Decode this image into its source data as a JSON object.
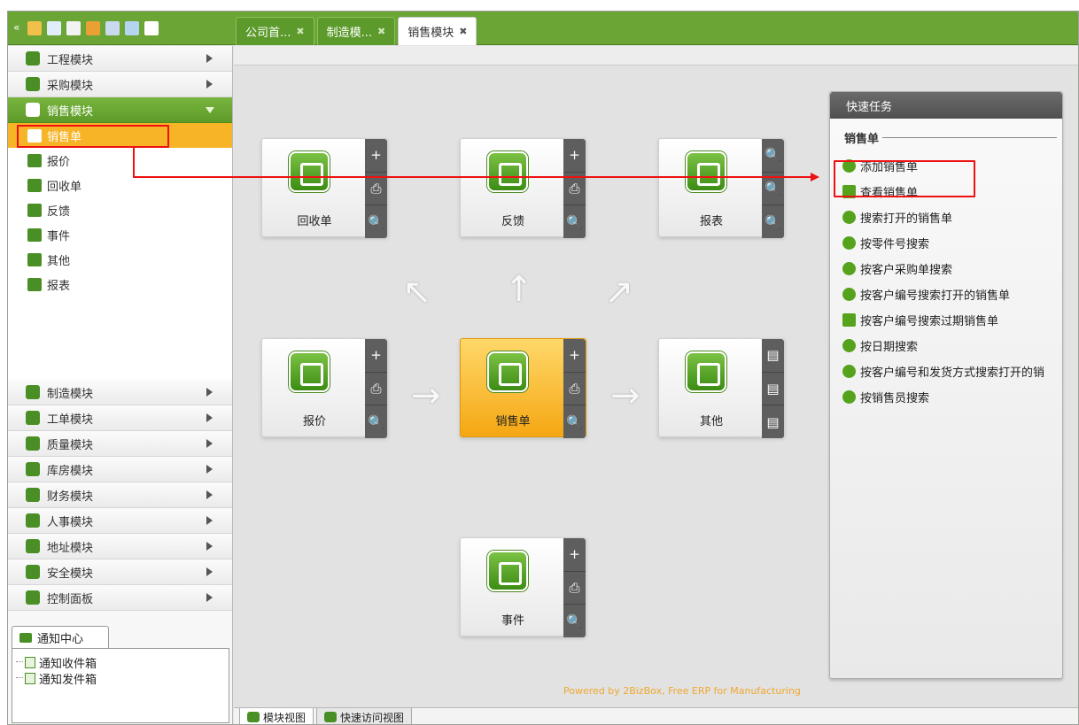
{
  "tabs": [
    {
      "label": "公司首...",
      "active": false
    },
    {
      "label": "制造模...",
      "active": false
    },
    {
      "label": "销售模块",
      "active": true
    }
  ],
  "tab_close_glyph": "✖",
  "sidebar": {
    "modules_top": [
      {
        "label": "工程模块",
        "icon": "module-icon"
      },
      {
        "label": "采购模块",
        "icon": "module-icon"
      },
      {
        "label": "销售模块",
        "icon": "module-icon",
        "open": true
      }
    ],
    "sub_items": [
      {
        "label": "销售单",
        "icon": "sales-order-icon",
        "selected": true
      },
      {
        "label": "报价",
        "icon": "quote-icon"
      },
      {
        "label": "回收单",
        "icon": "return-icon"
      },
      {
        "label": "反馈",
        "icon": "feedback-icon"
      },
      {
        "label": "事件",
        "icon": "event-icon"
      },
      {
        "label": "其他",
        "icon": "other-icon"
      },
      {
        "label": "报表",
        "icon": "report-icon"
      }
    ],
    "modules_bottom": [
      {
        "label": "制造模块"
      },
      {
        "label": "工单模块"
      },
      {
        "label": "质量模块"
      },
      {
        "label": "库房模块"
      },
      {
        "label": "财务模块"
      },
      {
        "label": "人事模块"
      },
      {
        "label": "地址模块"
      },
      {
        "label": "安全模块"
      },
      {
        "label": "控制面板"
      }
    ],
    "notify_tab": "通知中心",
    "notify_items": [
      "通知收件箱",
      "通知发件箱"
    ]
  },
  "cards": {
    "return": {
      "label": "回收单",
      "side": [
        "+",
        "⎙",
        "🔍"
      ]
    },
    "feedback": {
      "label": "反馈",
      "side": [
        "+",
        "⎙",
        "🔍"
      ]
    },
    "report": {
      "label": "报表",
      "side": [
        "🔍",
        "🔍",
        "🔍"
      ]
    },
    "quote": {
      "label": "报价",
      "side": [
        "+",
        "⎙",
        "🔍"
      ]
    },
    "sales": {
      "label": "销售单",
      "side": [
        "+",
        "⎙",
        "🔍"
      ]
    },
    "other": {
      "label": "其他",
      "side": [
        "▤",
        "▤",
        "▤"
      ]
    },
    "event": {
      "label": "事件",
      "side": [
        "+",
        "⎙",
        "🔍"
      ]
    }
  },
  "quick_tasks": {
    "title": "快速任务",
    "section": "销售单",
    "items": [
      {
        "label": "添加销售单",
        "icon": "add-icon"
      },
      {
        "label": "查看销售单",
        "icon": "view-icon"
      },
      {
        "label": "搜索打开的销售单",
        "icon": "search-icon"
      },
      {
        "label": "按零件号搜索",
        "icon": "search-icon"
      },
      {
        "label": "按客户采购单搜索",
        "icon": "search-icon"
      },
      {
        "label": "按客户编号搜索打开的销售单",
        "icon": "search-icon"
      },
      {
        "label": "按客户编号搜索过期销售单",
        "icon": "module-icon"
      },
      {
        "label": "按日期搜索",
        "icon": "search-icon"
      },
      {
        "label": "按客户编号和发货方式搜索打开的销",
        "icon": "search-icon"
      },
      {
        "label": "按销售员搜索",
        "icon": "search-icon"
      }
    ]
  },
  "powered_by": "Powered by 2BizBox, Free ERP for Manufacturing",
  "bottom_tabs": [
    {
      "label": "模块视图",
      "active": true
    },
    {
      "label": "快速访问视图",
      "active": false
    }
  ],
  "colors": {
    "accent": "#6aa535",
    "selected": "#f7b426",
    "annotation": "#ee1111"
  }
}
